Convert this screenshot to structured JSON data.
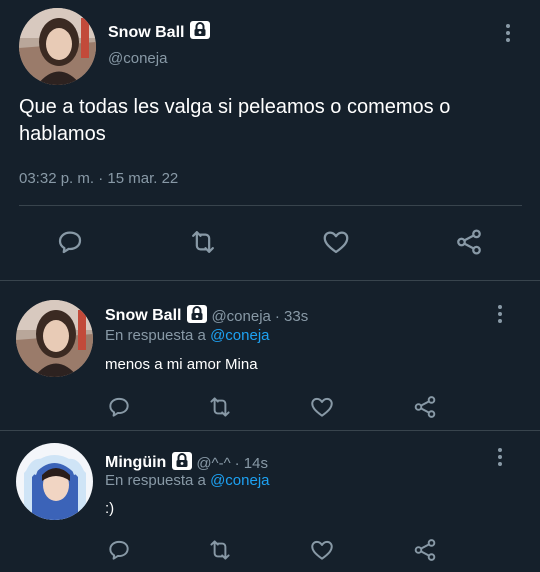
{
  "colors": {
    "background": "#15202b",
    "text": "#ffffff",
    "secondary": "#8899a6",
    "accent": "#1da1f2",
    "divider": "#38444d"
  },
  "main_tweet": {
    "display_name": "Snow Ball",
    "handle": "@coneja",
    "text": "Que a todas les valga si peleamos o comemos o hablamos",
    "timestamp": "03:32 p. m. · 15 mar. 22",
    "actions": [
      "reply-icon",
      "retweet-icon",
      "like-icon",
      "share-icon"
    ]
  },
  "replies": [
    {
      "display_name": "Snow Ball",
      "handle": "@coneja",
      "age": "· 33s",
      "reply_prefix": "En respuesta a",
      "reply_to": "@coneja",
      "text": "menos a mi amor Mina"
    },
    {
      "display_name": "Mingüin",
      "handle": "@^-^",
      "age": "· 14s",
      "reply_prefix": "En respuesta a",
      "reply_to": "@coneja",
      "text": ":)"
    }
  ]
}
